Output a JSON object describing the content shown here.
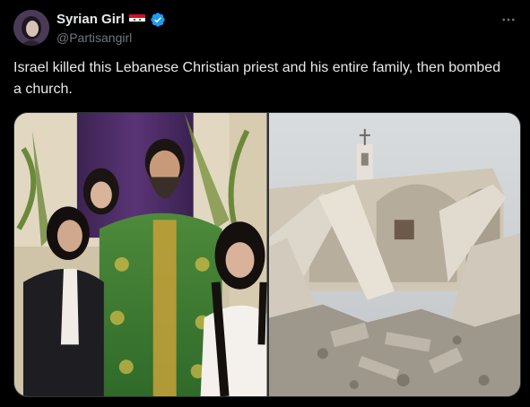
{
  "tweet": {
    "author": {
      "display_name": "Syrian Girl",
      "handle": "@Partisangirl",
      "flag_icon": "syria-flag-icon",
      "verified_icon": "verified-badge-icon",
      "verified_color": "#1d9bf0"
    },
    "text": "Israel killed this Lebanese Christian priest and his entire family, then bombed a church.",
    "more_icon": "more-options-icon",
    "media": [
      {
        "icon": "family-photo-image"
      },
      {
        "icon": "destroyed-church-image"
      }
    ]
  },
  "colors": {
    "background": "#000000",
    "text_primary": "#e7e9ea",
    "text_secondary": "#71767b",
    "border": "#2f3336"
  }
}
